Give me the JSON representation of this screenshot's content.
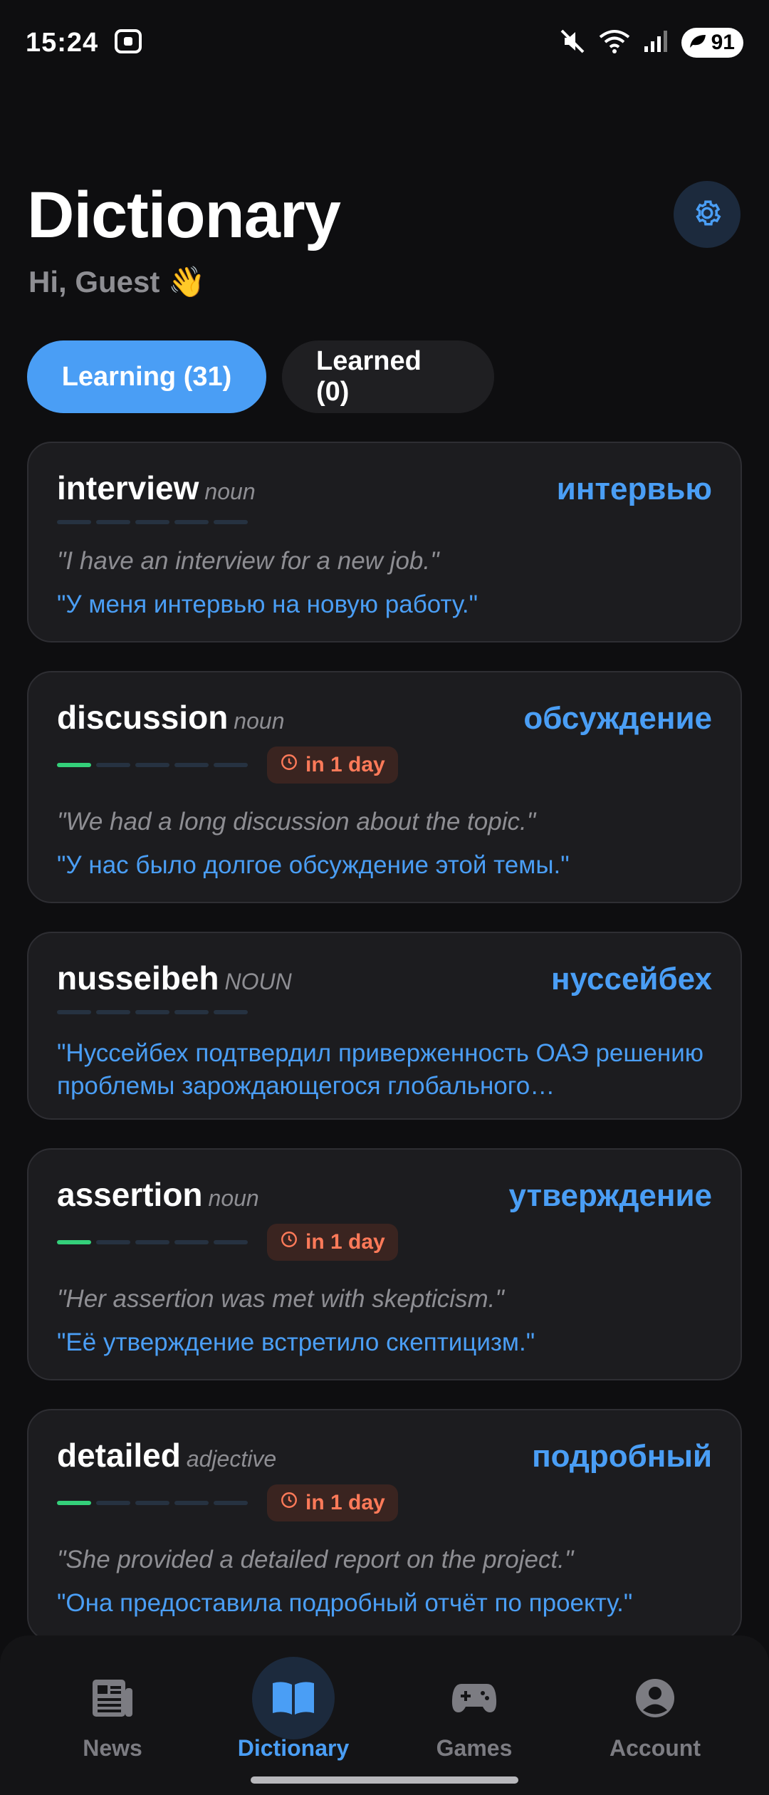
{
  "status_bar": {
    "time": "15:24",
    "battery": "91"
  },
  "header": {
    "title": "Dictionary",
    "greeting": "Hi, Guest 👋"
  },
  "tabs": [
    {
      "label": "Learning (31)",
      "active": true
    },
    {
      "label": "Learned (0)",
      "active": false
    }
  ],
  "cards": [
    {
      "word": "interview",
      "pos": "noun",
      "translation": "интервью",
      "progress": 0,
      "due": "",
      "example_en": "\"I have an interview for a new job.\"",
      "example_ru": "\"У меня интервью на новую работу.\""
    },
    {
      "word": "discussion",
      "pos": "noun",
      "translation": "обсуждение",
      "progress": 1,
      "due": "in 1 day",
      "example_en": "\"We had a long discussion about the topic.\"",
      "example_ru": "\"У нас было долгое обсуждение этой темы.\""
    },
    {
      "word": "nusseibeh",
      "pos": "NOUN",
      "translation": "нуссейбех",
      "progress": 0,
      "due": "",
      "example_en": "",
      "example_ru": "\"Нуссейбех подтвердил приверженность ОАЭ решению проблемы зарождающегося глобального…"
    },
    {
      "word": "assertion",
      "pos": "noun",
      "translation": "утверждение",
      "progress": 1,
      "due": "in 1 day",
      "example_en": "\"Her assertion was met with skepticism.\"",
      "example_ru": "\"Её утверждение встретило скептицизм.\""
    },
    {
      "word": "detailed",
      "pos": "adjective",
      "translation": "подробный",
      "progress": 1,
      "due": "in 1 day",
      "example_en": "\"She provided a detailed report on the project.\"",
      "example_ru": "\"Она предоставила подробный отчёт по проекту.\""
    }
  ],
  "nav": [
    {
      "label": "News",
      "icon": "news-icon",
      "active": false
    },
    {
      "label": "Dictionary",
      "icon": "book-icon",
      "active": true
    },
    {
      "label": "Games",
      "icon": "gamepad-icon",
      "active": false
    },
    {
      "label": "Account",
      "icon": "account-icon",
      "active": false
    }
  ],
  "colors": {
    "accent": "#4a9ef5",
    "progress": "#34d07a",
    "due": "#ff7a59",
    "background": "#0e0e10"
  }
}
